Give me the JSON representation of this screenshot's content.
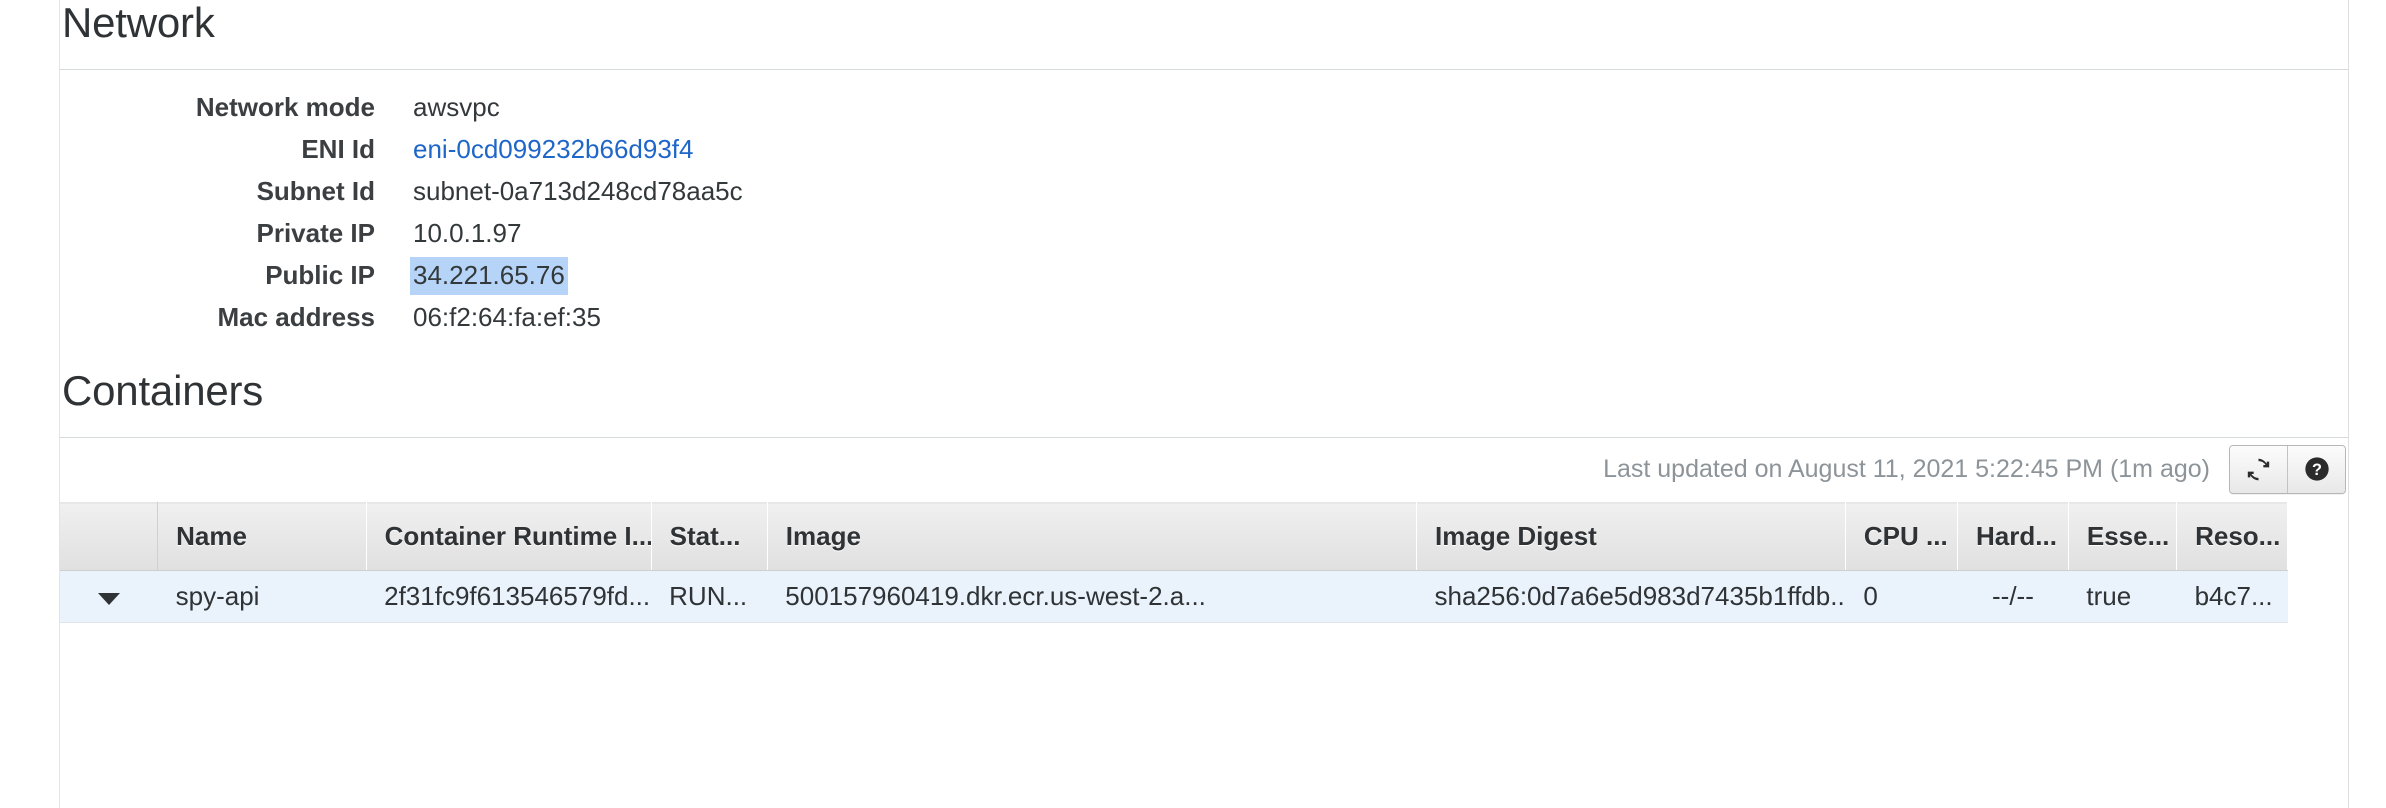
{
  "network": {
    "title": "Network",
    "rows": [
      {
        "label": "Network mode",
        "value": "awsvpc",
        "kind": "text"
      },
      {
        "label": "ENI Id",
        "value": "eni-0cd099232b66d93f4",
        "kind": "link"
      },
      {
        "label": "Subnet Id",
        "value": "subnet-0a713d248cd78aa5c",
        "kind": "text"
      },
      {
        "label": "Private IP",
        "value": "10.0.1.97",
        "kind": "text"
      },
      {
        "label": "Public IP",
        "value": "34.221.65.76",
        "kind": "selected"
      },
      {
        "label": "Mac address",
        "value": "06:f2:64:fa:ef:35",
        "kind": "text"
      }
    ]
  },
  "containers": {
    "title": "Containers",
    "toolbar": {
      "last_updated": "Last updated on August 11, 2021 5:22:45 PM (1m ago)",
      "refresh_icon": "refresh-icon",
      "help_icon": "help-icon"
    },
    "table": {
      "columns": [
        {
          "key": "expander",
          "label": ""
        },
        {
          "key": "name",
          "label": "Name"
        },
        {
          "key": "runtime_id",
          "label": "Container Runtime I..."
        },
        {
          "key": "status",
          "label": "Stat..."
        },
        {
          "key": "image",
          "label": "Image"
        },
        {
          "key": "image_digest",
          "label": "Image Digest"
        },
        {
          "key": "cpu",
          "label": "CPU ..."
        },
        {
          "key": "hard",
          "label": "Hard..."
        },
        {
          "key": "essential",
          "label": "Esse..."
        },
        {
          "key": "resource",
          "label": "Reso..."
        }
      ],
      "rows": [
        {
          "expander": "▼",
          "name": "spy-api",
          "runtime_id": "2f31fc9f613546579fd...",
          "status": "RUN...",
          "image": "500157960419.dkr.ecr.us-west-2.a...",
          "image_digest": "sha256:0d7a6e5d983d7435b1ffdb...",
          "cpu": "0",
          "hard": "--/--",
          "essential": "true",
          "resource": "b4c7..."
        }
      ]
    }
  },
  "colors": {
    "link": "#1f66c9",
    "selection": "#b6d4f7",
    "status_running": "#1d8102",
    "row_background": "#eaf2fb",
    "muted_text": "#8d9499"
  }
}
